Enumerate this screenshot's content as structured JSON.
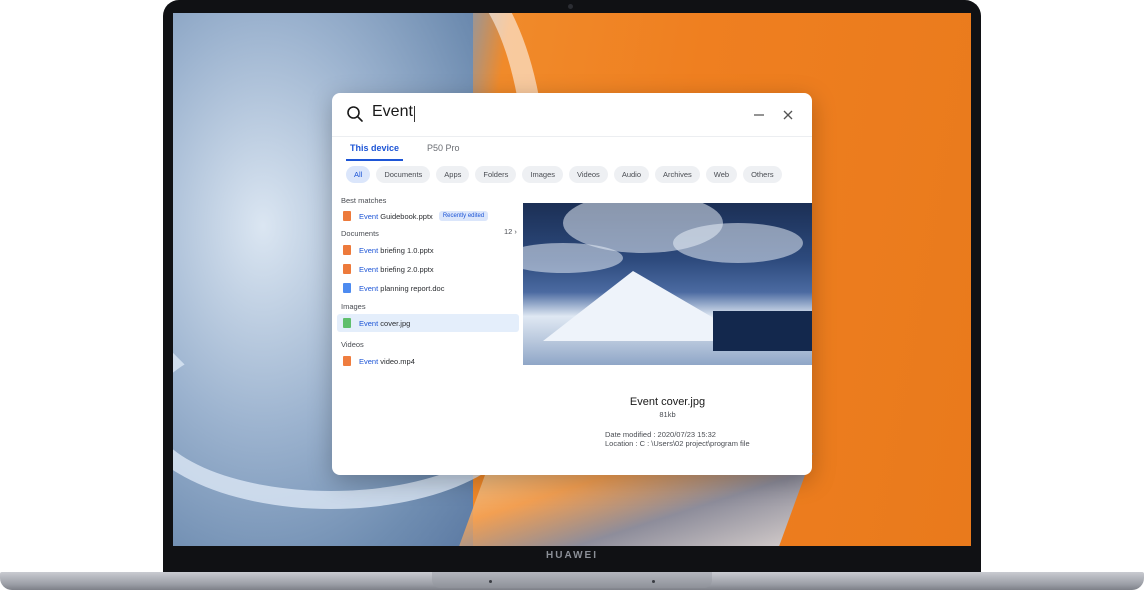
{
  "device": {
    "brand": "HUAWEI"
  },
  "search": {
    "query": "Event"
  },
  "tabs": [
    {
      "label": "This device",
      "active": true
    },
    {
      "label": "P50 Pro",
      "active": false
    }
  ],
  "filters": [
    "All",
    "Documents",
    "Apps",
    "Folders",
    "Images",
    "Videos",
    "Audio",
    "Archives",
    "Web",
    "Others"
  ],
  "results": {
    "best_matches_title": "Best matches",
    "best_match": {
      "highlight": "Event",
      "rest": " Guidebook.pptx",
      "badge": "Recently edited",
      "icon": "pptx-file-icon"
    },
    "documents_title": "Documents",
    "documents_count": "12",
    "documents": [
      {
        "highlight": "Event",
        "rest": " briefing 1.0.pptx",
        "icon": "pptx-file-icon"
      },
      {
        "highlight": "Event",
        "rest": " briefing 2.0.pptx",
        "icon": "pptx-file-icon"
      },
      {
        "highlight": "Event",
        "rest": " planning report.doc",
        "icon": "doc-file-icon"
      }
    ],
    "images_title": "Images",
    "images": [
      {
        "highlight": "Event",
        "rest": " cover.jpg",
        "icon": "image-file-icon"
      }
    ],
    "videos_title": "Videos",
    "videos": [
      {
        "highlight": "Event",
        "rest": " video.mp4",
        "icon": "video-file-icon"
      }
    ]
  },
  "preview": {
    "name": "Event cover.jpg",
    "size": "81kb",
    "date_modified": "Date modified  : 2020/07/23 15:32",
    "location": "Location : C : \\Users\\02 project\\program file"
  },
  "colors": {
    "accent": "#1d55d6",
    "window_bg": "#ffffff"
  }
}
